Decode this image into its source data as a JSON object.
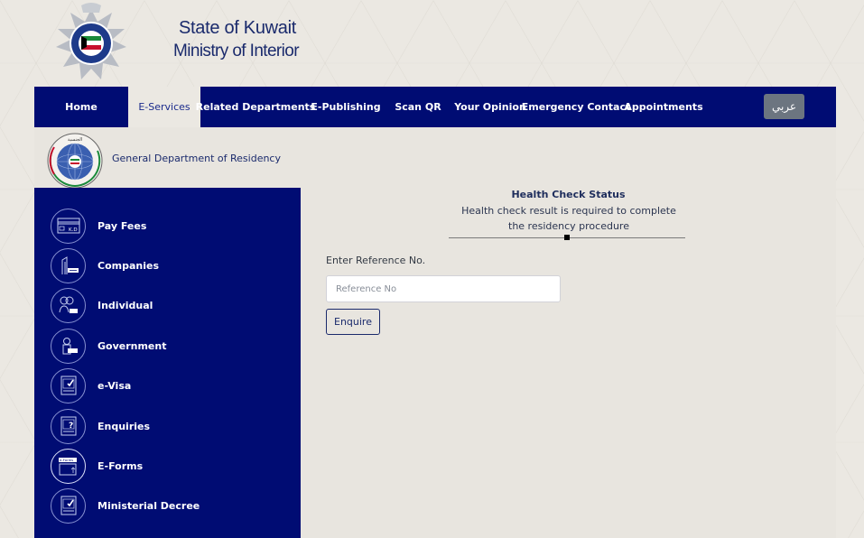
{
  "header": {
    "logo_alt": "Kuwait Police",
    "title_line1": "State of Kuwait",
    "title_line2": "Ministry of Interior"
  },
  "nav": {
    "items": [
      {
        "label": "Home",
        "active": false
      },
      {
        "label": "E-Services",
        "active": true
      },
      {
        "label": "Related Departments",
        "active": false
      },
      {
        "label": "E-Publishing",
        "active": false
      },
      {
        "label": "Scan QR",
        "active": false
      },
      {
        "label": "Your Opinion",
        "active": false
      },
      {
        "label": "Emergency Contact",
        "active": false
      },
      {
        "label": "Appointments",
        "active": false
      }
    ],
    "language_button": "عربي"
  },
  "department": {
    "title": "General Department of Residency"
  },
  "sidebar": {
    "items": [
      {
        "label": "Pay Fees",
        "icon": "card-kd-icon"
      },
      {
        "label": "Companies",
        "icon": "building-icon"
      },
      {
        "label": "Individual",
        "icon": "people-icon"
      },
      {
        "label": "Government",
        "icon": "government-icon"
      },
      {
        "label": "e-Visa",
        "icon": "document-check-icon"
      },
      {
        "label": "Enquiries",
        "icon": "document-question-icon"
      },
      {
        "label": "E-Forms",
        "icon": "eforms-icon"
      },
      {
        "label": "Ministerial Decree",
        "icon": "document-check-icon"
      }
    ]
  },
  "main": {
    "heading": "Health Check Status",
    "description": "Health check result is required to complete the residency procedure",
    "reference_label": "Enter Reference No.",
    "reference_placeholder": "Reference No",
    "reference_value": "",
    "enquire_button": "Enquire"
  },
  "colors": {
    "primary_navy": "#000c73",
    "background": "#ebe8e2",
    "language_button": "#6c7580",
    "text_dark_blue": "#1a2a6c"
  }
}
